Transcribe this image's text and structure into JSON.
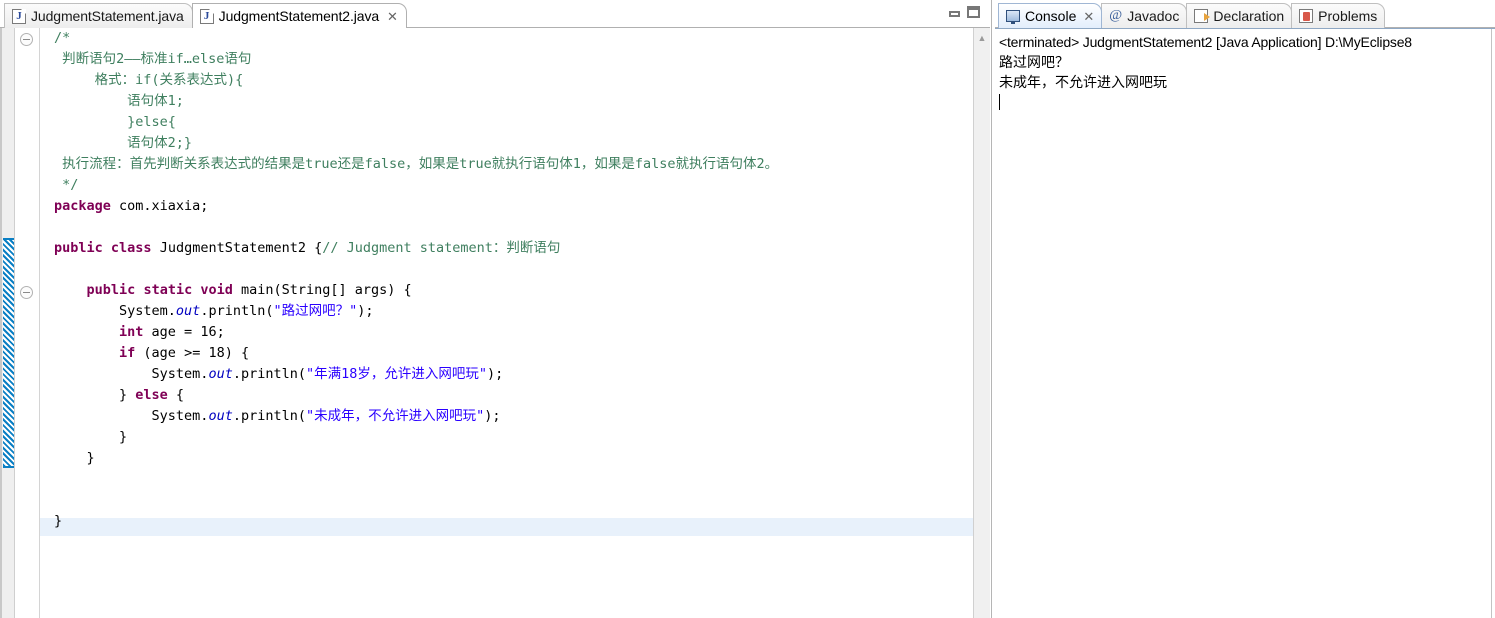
{
  "editor": {
    "tabs": [
      {
        "label": "JudgmentStatement.java",
        "icon": "java-file-icon",
        "active": false,
        "closable": false
      },
      {
        "label": "JudgmentStatement2.java",
        "icon": "java-file-icon",
        "active": true,
        "closable": true,
        "close_glyph": "✕"
      }
    ],
    "window_controls": [
      {
        "name": "minimize-button",
        "glyph": ""
      },
      {
        "name": "maximize-button",
        "glyph": ""
      }
    ],
    "scrollbar": {
      "up_arrow": "▲"
    },
    "code_lines": [
      "/*",
      " 判断语句2——标准if…else语句",
      "     格式：if(关系表达式){",
      "         语句体1;",
      "         }else{",
      "         语句体2;}",
      " 执行流程：首先判断关系表达式的结果是true还是false，如果是true就执行语句体1，如果是false就执行语句体2。",
      " */",
      "package com.xiaxia;",
      "",
      "public class JudgmentStatement2 {// Judgment statement：判断语句",
      "",
      "    public static void main(String[] args) {",
      "        System.out.println(\"路过网吧？\");",
      "        int age = 16;",
      "        if (age >= 18) {",
      "            System.out.println(\"年满18岁，允许进入网吧玩\");",
      "        } else {",
      "            System.out.println(\"未成年，不允许进入网吧玩\");",
      "        }",
      "    }",
      "",
      "",
      "}"
    ],
    "colors": {
      "keyword": "#7f0055",
      "comment": "#3f7f5f",
      "string": "#2a00ff",
      "static_field": "#0000c0",
      "current_line_highlight": "#e8f1fb",
      "change_bar": "#0a7fc4"
    }
  },
  "console": {
    "tabs": [
      {
        "label": "Console",
        "icon": "console-monitor-icon",
        "active": true,
        "closable": true,
        "close_glyph": "✕"
      },
      {
        "label": "Javadoc",
        "icon": "at-sign-icon",
        "active": false,
        "closable": false
      },
      {
        "label": "Declaration",
        "icon": "declaration-icon",
        "active": false,
        "closable": false
      },
      {
        "label": "Problems",
        "icon": "problems-icon",
        "active": false,
        "closable": false
      }
    ],
    "header": "<terminated> JudgmentStatement2 [Java Application] D:\\MyEclipse8",
    "output_lines": [
      "路过网吧？",
      "未成年，不允许进入网吧玩"
    ]
  }
}
